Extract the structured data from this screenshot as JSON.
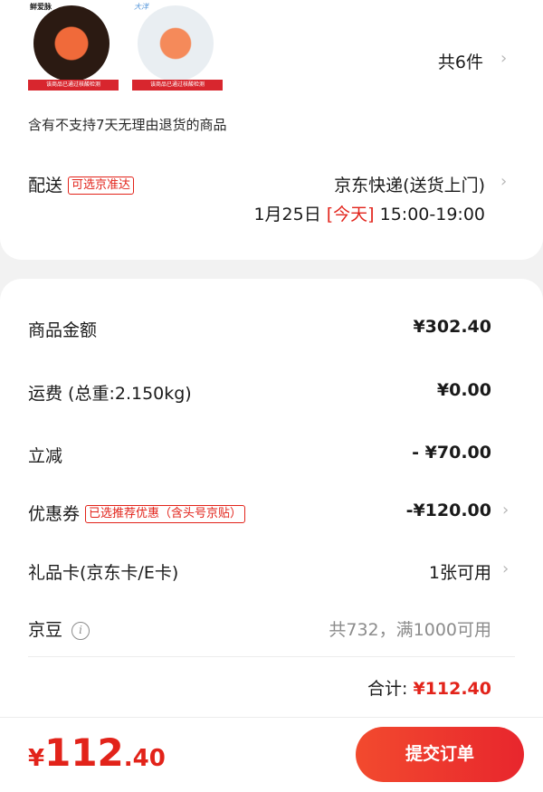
{
  "products": {
    "thumbs": [
      {
        "brand": "鲜爱脉",
        "tag": "该商品已通过核酸检测"
      },
      {
        "brand": "大洋",
        "tag": "该商品已通过核酸检测"
      }
    ],
    "count": "共6件"
  },
  "notice": "含有不支持7天无理由退货的商品",
  "delivery": {
    "label": "配送",
    "badge": "可选京准达",
    "method": "京东快递(送货上门)",
    "date": "1月25日",
    "day": "[今天]",
    "window": "15:00-19:00"
  },
  "summary": {
    "goods_label": "商品金额",
    "goods_value": "¥302.40",
    "shipping_label": "运费 (总重:2.150kg)",
    "shipping_value": "¥0.00",
    "discount_label": "立减",
    "discount_value": "- ¥70.00",
    "coupon_label": "优惠券",
    "coupon_badge": "已选推荐优惠（含头号京贴）",
    "coupon_value": "-¥120.00",
    "giftcard_label": "礼品卡(京东卡/E卡)",
    "giftcard_value": "1张可用",
    "beans_label": "京豆",
    "beans_value": "共732，满1000可用",
    "total_label": "合计:",
    "total_value": "¥112.40"
  },
  "footer": {
    "currency": "¥",
    "price_int": "112",
    "price_dec": ".40",
    "submit_label": "提交订单"
  },
  "colors": {
    "accent": "#e2231a",
    "button": "#f03a2c"
  }
}
